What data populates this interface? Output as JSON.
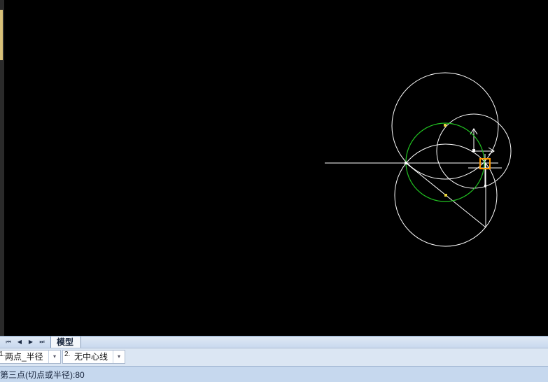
{
  "layout_tabs": {
    "nav_first": "⏮",
    "nav_prev": "◀",
    "nav_next": "▶",
    "nav_last": "⏭",
    "active_tab": "模型"
  },
  "options": [
    {
      "num": "1.",
      "label": "两点_半径",
      "arrow": "▾"
    },
    {
      "num": "2.",
      "label": "无中心线",
      "arrow": "▾"
    }
  ],
  "status": {
    "prompt": "第三点(切点或半径):80"
  },
  "colors": {
    "canvas_bg": "#000000",
    "entity_white": "#ffffff",
    "entity_green": "#22c322",
    "cursor_orange": "#ff9900",
    "marker_yellow": "#e6d23a"
  }
}
